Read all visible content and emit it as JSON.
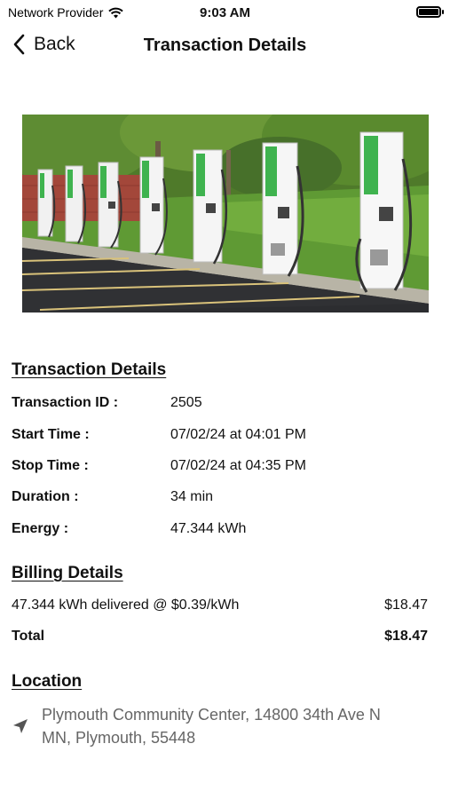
{
  "status_bar": {
    "carrier": "Network Provider",
    "time": "9:03 AM"
  },
  "nav": {
    "back_label": "Back",
    "title": "Transaction Details"
  },
  "transaction": {
    "section_title": "Transaction Details",
    "rows": [
      {
        "label": "Transaction ID :",
        "value": "2505"
      },
      {
        "label": "Start Time :",
        "value": "07/02/24 at 04:01 PM"
      },
      {
        "label": "Stop Time :",
        "value": "07/02/24 at 04:35 PM"
      },
      {
        "label": "Duration :",
        "value": "34 min"
      },
      {
        "label": "Energy :",
        "value": "47.344 kWh"
      }
    ]
  },
  "billing": {
    "section_title": "Billing Details",
    "line_item": {
      "description": "47.344 kWh delivered @ $0.39/kWh",
      "amount": "$18.47"
    },
    "total": {
      "label": "Total",
      "amount": "$18.47"
    }
  },
  "location": {
    "section_title": "Location",
    "address_line1": "Plymouth Community Center, 14800 34th Ave N",
    "address_line2": "MN, Plymouth, 55448"
  },
  "icons": {
    "wifi": "wifi-icon",
    "battery": "battery-icon",
    "back": "chevron-left-icon",
    "location": "location-arrow-icon"
  },
  "colors": {
    "text": "#111111",
    "address_text": "#666666",
    "charger_accent": "#3fb34f"
  }
}
